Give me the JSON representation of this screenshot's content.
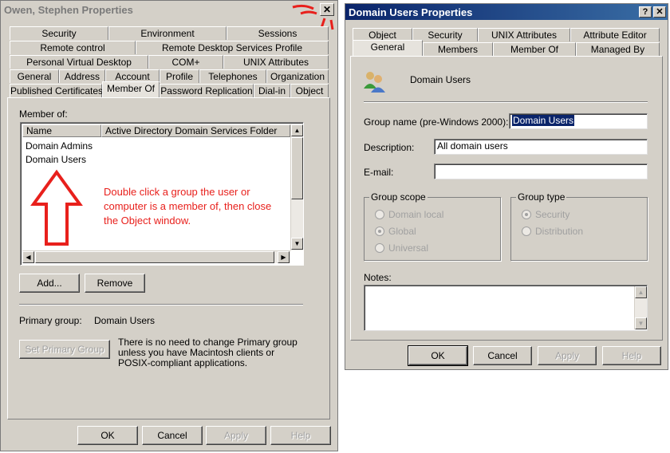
{
  "left": {
    "title": "Owen, Stephen Properties",
    "tabs_row1": [
      "Security",
      "Environment",
      "Sessions"
    ],
    "tabs_row2": [
      "Remote control",
      "Remote Desktop Services Profile"
    ],
    "tabs_row3": [
      "Personal Virtual Desktop",
      "COM+",
      "UNIX Attributes"
    ],
    "tabs_row4": [
      "General",
      "Address",
      "Account",
      "Profile",
      "Telephones",
      "Organization"
    ],
    "tabs_row5": [
      "Published Certificates",
      "Member Of",
      "Password Replication",
      "Dial-in",
      "Object"
    ],
    "member_of_label": "Member of:",
    "col_name": "Name",
    "col_folder": "Active Directory Domain Services Folder",
    "rows": [
      "Domain Admins",
      "Domain Users"
    ],
    "annotation": "Double click a group the user or computer is a member of, then close the Object window.",
    "add_btn": "Add...",
    "remove_btn": "Remove",
    "primary_group_label": "Primary group:",
    "primary_group_value": "Domain Users",
    "set_primary_btn": "Set Primary Group",
    "note": "There is no need to change Primary group unless you have Macintosh clients or POSIX-compliant applications.",
    "ok": "OK",
    "cancel": "Cancel",
    "apply": "Apply",
    "help": "Help",
    "close_glyph": "✕"
  },
  "right": {
    "title": "Domain Users Properties",
    "help_glyph": "?",
    "close_glyph": "✕",
    "tabs_row1": [
      "Object",
      "Security",
      "UNIX Attributes",
      "Attribute Editor"
    ],
    "tabs_row2": [
      "General",
      "Members",
      "Member Of",
      "Managed By"
    ],
    "group_display": "Domain Users",
    "group_name_label": "Group name (pre-Windows 2000):",
    "group_name_value": "Domain Users",
    "description_label": "Description:",
    "description_value": "All domain users",
    "email_label": "E-mail:",
    "email_value": "",
    "scope_title": "Group scope",
    "scope_options": [
      "Domain local",
      "Global",
      "Universal"
    ],
    "type_title": "Group type",
    "type_options": [
      "Security",
      "Distribution"
    ],
    "notes_label": "Notes:",
    "ok": "OK",
    "cancel": "Cancel",
    "apply": "Apply",
    "help": "Help"
  },
  "colors": {
    "annotation": "#e8201c",
    "arrow": "#e8201c",
    "title_active": "#0a246a",
    "selection": "#0a246a"
  }
}
